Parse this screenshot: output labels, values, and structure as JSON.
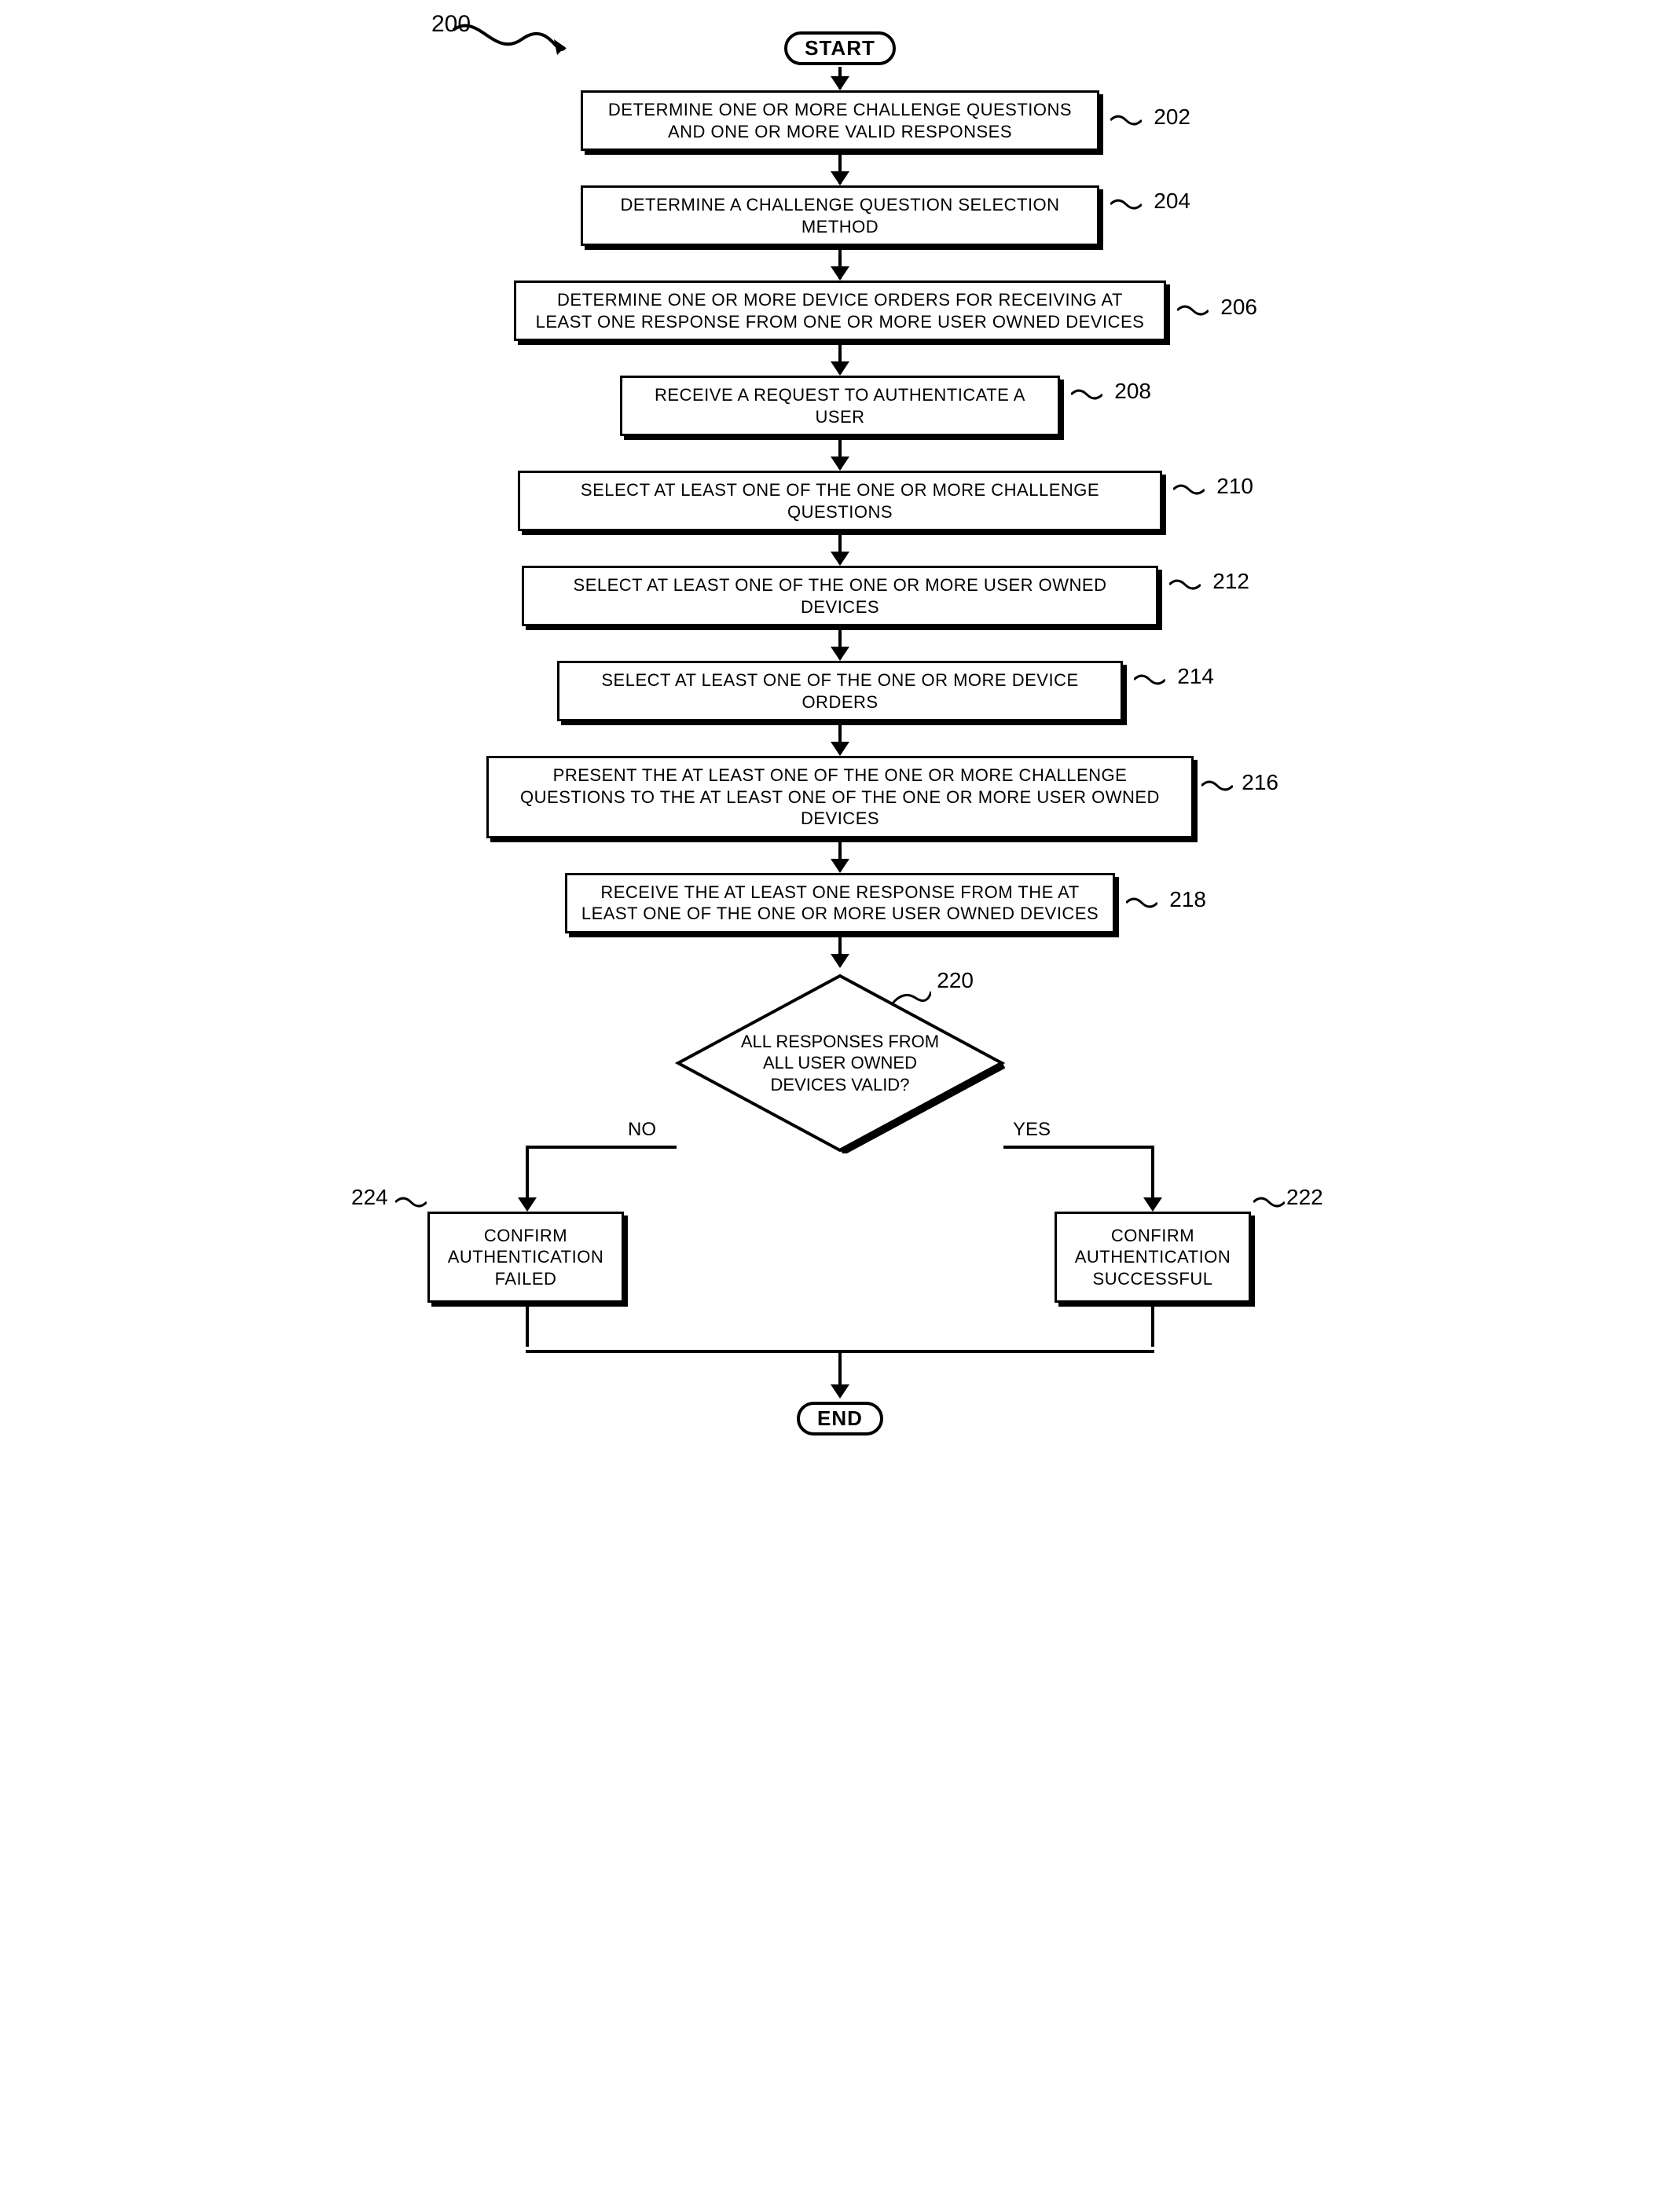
{
  "figure_ref": "200",
  "terminators": {
    "start": "START",
    "end": "END"
  },
  "decision": {
    "text": "ALL RESPONSES FROM ALL USER OWNED DEVICES VALID?",
    "no_label": "NO",
    "yes_label": "YES",
    "ref": "220"
  },
  "steps": {
    "s202": {
      "text": "DETERMINE ONE OR MORE CHALLENGE QUESTIONS AND ONE OR MORE VALID RESPONSES",
      "ref": "202"
    },
    "s204": {
      "text": "DETERMINE A CHALLENGE QUESTION SELECTION METHOD",
      "ref": "204"
    },
    "s206": {
      "text": "DETERMINE ONE OR MORE DEVICE ORDERS FOR RECEIVING AT LEAST ONE RESPONSE FROM ONE OR MORE USER OWNED DEVICES",
      "ref": "206"
    },
    "s208": {
      "text": "RECEIVE A REQUEST TO AUTHENTICATE A USER",
      "ref": "208"
    },
    "s210": {
      "text": "SELECT AT LEAST ONE OF THE ONE OR MORE CHALLENGE QUESTIONS",
      "ref": "210"
    },
    "s212": {
      "text": "SELECT AT LEAST ONE OF THE ONE OR MORE USER OWNED DEVICES",
      "ref": "212"
    },
    "s214": {
      "text": "SELECT AT LEAST ONE OF THE ONE OR MORE DEVICE ORDERS",
      "ref": "214"
    },
    "s216": {
      "text": "PRESENT THE AT LEAST ONE OF THE ONE OR MORE CHALLENGE QUESTIONS TO THE AT LEAST ONE OF THE ONE OR MORE USER OWNED DEVICES",
      "ref": "216"
    },
    "s218": {
      "text": "RECEIVE THE AT LEAST ONE RESPONSE FROM THE AT LEAST ONE OF THE ONE OR MORE USER OWNED DEVICES",
      "ref": "218"
    }
  },
  "outcomes": {
    "fail": {
      "text": "CONFIRM AUTHENTICATION FAILED",
      "ref": "224"
    },
    "success": {
      "text": "CONFIRM AUTHENTICATION SUCCESSFUL",
      "ref": "222"
    }
  }
}
